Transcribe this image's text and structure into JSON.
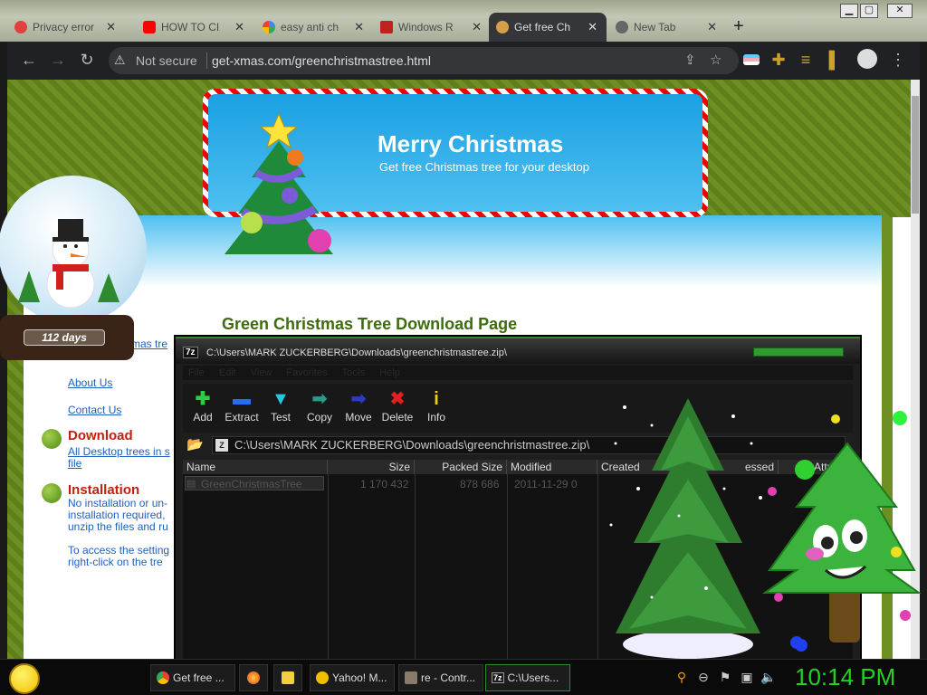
{
  "browser": {
    "tabs": [
      {
        "label": "Privacy error",
        "favicon": "warning-icon"
      },
      {
        "label": "HOW TO CI",
        "favicon": "youtube-icon"
      },
      {
        "label": "easy anti ch",
        "favicon": "google-icon"
      },
      {
        "label": "Windows R",
        "favicon": "page-icon"
      },
      {
        "label": "Get free Ch",
        "favicon": "tree-icon",
        "active": true
      },
      {
        "label": "New Tab",
        "favicon": "chrome-icon"
      }
    ],
    "new_tab": "+",
    "security": "Not secure",
    "url": "get-xmas.com/greenchristmastree.html"
  },
  "page": {
    "banner_title": "Merry Christmas",
    "banner_subtitle": "Get free Christmas tree for your desktop",
    "heading": "Green Christmas Tree Download Page",
    "countdown": "112 days",
    "left_partial_link": "mas tre",
    "links": {
      "about": "About Us",
      "contact": "Contact Us"
    },
    "download": {
      "title": "Download",
      "lines": [
        "All Desktop trees in s",
        "file"
      ]
    },
    "installation": {
      "title": "Installation",
      "lines": [
        "No installation or un-",
        "installation required,",
        "unzip the files and ru"
      ],
      "more": [
        "To access the setting",
        "right-click on the tre"
      ]
    }
  },
  "zip": {
    "title": "C:\\Users\\MARK ZUCKERBERG\\Downloads\\greenchristmastree.zip\\",
    "menu": [
      "File",
      "Edit",
      "View",
      "Favorites",
      "Tools",
      "Help"
    ],
    "toolbar": [
      {
        "label": "Add",
        "icon": "plus-icon",
        "color": "#2ecc40"
      },
      {
        "label": "Extract",
        "icon": "minus-icon",
        "color": "#2a6cf0"
      },
      {
        "label": "Test",
        "icon": "checkmark-icon",
        "color": "#20c8e0"
      },
      {
        "label": "Copy",
        "icon": "arrow-right-icon",
        "color": "#2a9a8a"
      },
      {
        "label": "Move",
        "icon": "arrow-right-icon",
        "color": "#2a3cc0"
      },
      {
        "label": "Delete",
        "icon": "x-icon",
        "color": "#e02020"
      },
      {
        "label": "Info",
        "icon": "info-icon",
        "color": "#f0d000"
      }
    ],
    "address": "C:\\Users\\MARK ZUCKERBERG\\Downloads\\greenchristmastree.zip\\",
    "columns": [
      "Name",
      "Size",
      "Packed Size",
      "Modified",
      "Created",
      "essed",
      "Attribut"
    ],
    "rows": [
      {
        "name": "GreenChristmasTree",
        "size": "1 170 432",
        "packed": "878 686",
        "modified": "2011-11-29 0"
      }
    ]
  },
  "taskbar": {
    "items": [
      {
        "label": "Get free ...",
        "icon": "chrome-icon"
      },
      {
        "label": "",
        "icon": "firefox-icon"
      },
      {
        "label": "",
        "icon": "folder-icon"
      },
      {
        "label": "Yahoo! M...",
        "icon": "yahoo-messenger-icon"
      },
      {
        "label": "re - Contr...",
        "icon": "control-panel-icon"
      },
      {
        "label": "C:\\Users...",
        "icon": "7zip-icon"
      }
    ],
    "clock": "10:14 PM"
  },
  "colors": {
    "clock": "#21d421",
    "page_green": "#6e8f22",
    "heading_green": "#3d6b0d",
    "link_blue": "#2060c0"
  }
}
